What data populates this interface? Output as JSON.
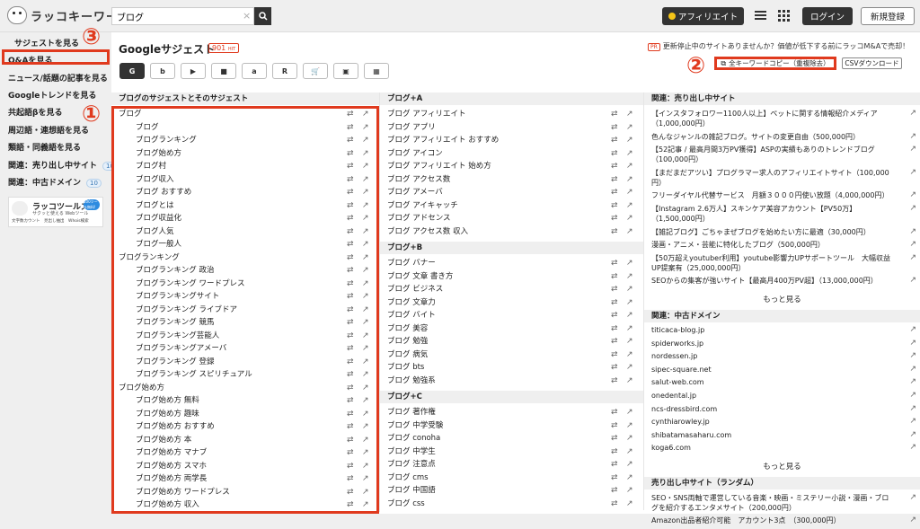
{
  "header": {
    "logo_text": "ラッコキーワード",
    "search_value": "ブログ",
    "clear": "×",
    "affiliate_label": "アフィリエイト",
    "login_label": "ログイン",
    "register_label": "新規登録"
  },
  "sidebar": {
    "items": [
      "サジェストを見る",
      "Q&Aを見る",
      "ニュース/話題の記事を見る",
      "Googleトレンドを見る",
      "共起語βを見る",
      "周辺語・連想語を見る",
      "類語・同義語を見る",
      "関連：売り出し中サイト",
      "関連：中古ドメイン"
    ],
    "badges": [
      "10",
      "10"
    ],
    "ad": {
      "title": "ラッコツールズ",
      "sub": "サクッと使える Webツール",
      "buttons": "文字数カウント　見出し抽出　Whois検索",
      "new_badge": "100ツール無料!"
    }
  },
  "annotations": [
    "①",
    "②",
    "③"
  ],
  "main": {
    "title": "Googleサジェスト",
    "hit_count": "901",
    "hit_unit": "HIT",
    "search_engines": [
      "G",
      "b",
      "▶",
      "■",
      "a",
      "R",
      "🛒",
      "▣",
      "▦"
    ],
    "pr_tag": "PR",
    "pr_text": "更新停止中のサイトありませんか？価値が低下する前にラッコM&Aで売却！",
    "copy_all_label": "全キーワードコピー（重複除去）",
    "csv_label": "CSVダウンロード",
    "col1": {
      "header": "ブログのサジェストとそのサジェスト",
      "rows": [
        {
          "t": "ブログ",
          "i": 0
        },
        {
          "t": "ブログ",
          "i": 1
        },
        {
          "t": "ブログランキング",
          "i": 1
        },
        {
          "t": "ブログ始め方",
          "i": 1
        },
        {
          "t": "ブログ村",
          "i": 1
        },
        {
          "t": "ブログ収入",
          "i": 1
        },
        {
          "t": "ブログ おすすめ",
          "i": 1
        },
        {
          "t": "ブログとは",
          "i": 1
        },
        {
          "t": "ブログ収益化",
          "i": 1
        },
        {
          "t": "ブログ人気",
          "i": 1
        },
        {
          "t": "ブログ一般人",
          "i": 1
        },
        {
          "t": "ブログランキング",
          "i": 0
        },
        {
          "t": "ブログランキング 政治",
          "i": 1
        },
        {
          "t": "ブログランキング ワードプレス",
          "i": 1
        },
        {
          "t": "ブログランキングサイト",
          "i": 1
        },
        {
          "t": "ブログランキング ライブドア",
          "i": 1
        },
        {
          "t": "ブログランキング 競馬",
          "i": 1
        },
        {
          "t": "ブログランキング芸能人",
          "i": 1
        },
        {
          "t": "ブログランキングアメーバ",
          "i": 1
        },
        {
          "t": "ブログランキング 登録",
          "i": 1
        },
        {
          "t": "ブログランキング スピリチュアル",
          "i": 1
        },
        {
          "t": "ブログ始め方",
          "i": 0
        },
        {
          "t": "ブログ始め方 無料",
          "i": 1
        },
        {
          "t": "ブログ始め方 趣味",
          "i": 1
        },
        {
          "t": "ブログ始め方 おすすめ",
          "i": 1
        },
        {
          "t": "ブログ始め方 本",
          "i": 1
        },
        {
          "t": "ブログ始め方 マナブ",
          "i": 1
        },
        {
          "t": "ブログ始め方 スマホ",
          "i": 1
        },
        {
          "t": "ブログ始め方 両学長",
          "i": 1
        },
        {
          "t": "ブログ始め方 ワードプレス",
          "i": 1
        },
        {
          "t": "ブログ始め方 収入",
          "i": 1
        }
      ]
    },
    "col2": {
      "groups": [
        {
          "header": "ブログ+A",
          "rows": [
            "ブログ アフィリエイト",
            "ブログ アプリ",
            "ブログ アフィリエイト おすすめ",
            "ブログ アイコン",
            "ブログ アフィリエイト 始め方",
            "ブログ アクセス数",
            "ブログ アメーバ",
            "ブログ アイキャッチ",
            "ブログ アドセンス",
            "ブログ アクセス数 収入"
          ]
        },
        {
          "header": "ブログ+B",
          "rows": [
            "ブログ バナー",
            "ブログ 文章 書き方",
            "ブログ ビジネス",
            "ブログ 文章力",
            "ブログ バイト",
            "ブログ 美容",
            "ブログ 勉強",
            "ブログ 病気",
            "ブログ bts",
            "ブログ 勉強系"
          ]
        },
        {
          "header": "ブログ+C",
          "rows": [
            "ブログ 著作権",
            "ブログ 中学受験",
            "ブログ conoha",
            "ブログ 中学生",
            "ブログ 注意点",
            "ブログ cms",
            "ブログ 中国語",
            "ブログ css"
          ]
        }
      ]
    },
    "col3": {
      "sale_header": "関連：売り出し中サイト",
      "sale_rows": [
        "【インスタフォロワー1100人以上】ペットに関する情報紹介メディア（1,000,000円）",
        "色んなジャンルの雑記ブログ。サイトの変更自由（500,000円）",
        "【52記事 / 最高月間3万PV獲得】ASPの実績もありのトレンドブログ（100,000円）",
        "【まだまだアツい】プログラマー求人のアフィリエイトサイト（100,000円）",
        "フリーダイヤル代替サービス　月額３０００円使い放題（4,000,000円）",
        "【Instagram 2.6万人】スキンケア美容アカウント【PV50万】（1,500,000円）",
        "【雑記ブログ】ごちゃまぜブログを始めたい方に最適（30,000円）",
        "漫画・アニメ・芸能に特化したブログ（500,000円）",
        "【50万超えyoutuber利用】youtube影響力UPサポートツール　大幅収益UP提案有（25,000,000円）",
        "SEOからの集客が強いサイト【最高月400万PV超】（13,000,000円）"
      ],
      "more_label": "もっと見る",
      "domain_header": "関連：中古ドメイン",
      "domain_rows": [
        "titicaca-blog.jp",
        "spiderworks.jp",
        "nordessen.jp",
        "sipec-square.net",
        "salut-web.com",
        "onedental.jp",
        "ncs-dressbird.com",
        "cynthiarowley.jp",
        "shibatamasaharu.com",
        "koga6.com"
      ],
      "random_header": "売り出し中サイト（ランダム）",
      "random_rows": [
        "SEO・SNS両軸で運営している音楽・映画・ミステリー小説・漫画・ブログを紹介するエンタメサイト（200,000円）",
        "Amazon出品者紹介可能　アカウント3点　（300,000円）"
      ]
    }
  }
}
